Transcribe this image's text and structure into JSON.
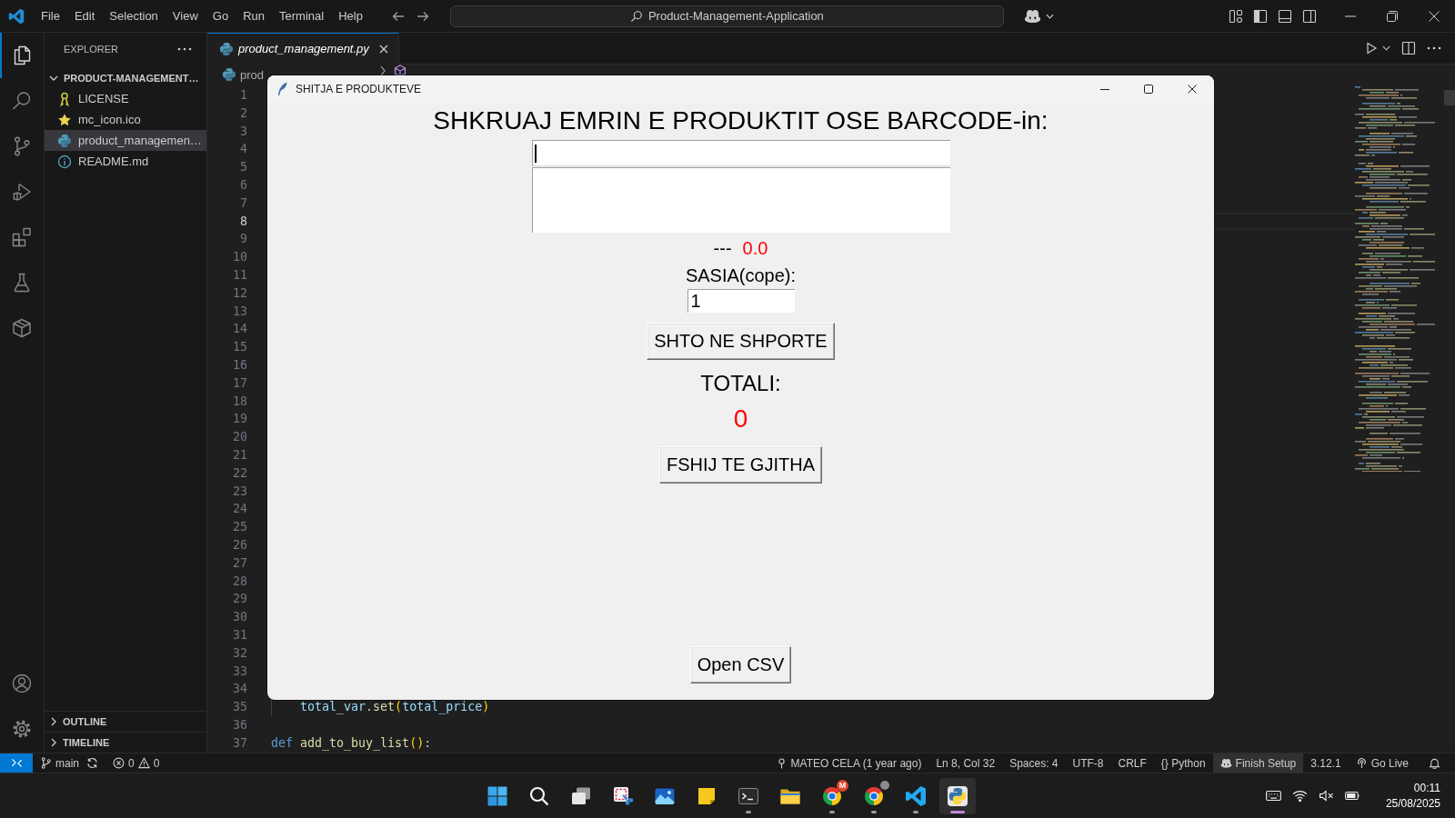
{
  "titlebar": {
    "menu": [
      "File",
      "Edit",
      "Selection",
      "View",
      "Go",
      "Run",
      "Terminal",
      "Help"
    ],
    "search": "Product-Management-Application"
  },
  "activity_bar": {
    "items": [
      {
        "kind": "explorer",
        "selected": true
      },
      {
        "kind": "search",
        "selected": false
      },
      {
        "kind": "source_control",
        "selected": false
      },
      {
        "kind": "run_debug",
        "selected": false
      },
      {
        "kind": "extensions",
        "selected": false
      },
      {
        "kind": "testing",
        "selected": false
      },
      {
        "kind": "containers",
        "selected": false
      }
    ]
  },
  "sidebar": {
    "title": "EXPLORER",
    "folder": {
      "name": "PRODUCT-MANAGEMENT…",
      "expanded": true,
      "children": [
        {
          "name": "LICENSE",
          "kind": "license",
          "selected": false
        },
        {
          "name": "mc_icon.ico",
          "kind": "image",
          "selected": false
        },
        {
          "name": "product_managemen…",
          "kind": "python",
          "selected": true
        },
        {
          "name": "README.md",
          "kind": "readme",
          "selected": false
        }
      ]
    },
    "sections": [
      {
        "name": "OUTLINE",
        "expanded": false
      },
      {
        "name": "TIMELINE",
        "expanded": false
      }
    ]
  },
  "tabs": [
    {
      "label": "product_management.py",
      "selected": true,
      "preview": true
    }
  ],
  "breadcrumb": {
    "file": "prod"
  },
  "editor": {
    "lines": [
      {
        "number": "1",
        "current": false
      },
      {
        "number": "2",
        "current": false
      },
      {
        "number": "3",
        "current": false
      },
      {
        "number": "4",
        "current": false
      },
      {
        "number": "5",
        "current": false
      },
      {
        "number": "6",
        "current": false
      },
      {
        "number": "7",
        "current": false
      },
      {
        "number": "8",
        "current": true
      },
      {
        "number": "9",
        "current": false
      },
      {
        "number": "10",
        "current": false
      },
      {
        "number": "11",
        "current": false
      },
      {
        "number": "12",
        "current": false
      },
      {
        "number": "13",
        "current": false
      },
      {
        "number": "14",
        "current": false
      },
      {
        "number": "15",
        "current": false
      },
      {
        "number": "16",
        "current": false
      },
      {
        "number": "17",
        "current": false
      },
      {
        "number": "18",
        "current": false
      },
      {
        "number": "19",
        "current": false
      },
      {
        "number": "20",
        "current": false
      },
      {
        "number": "21",
        "current": false
      },
      {
        "number": "22",
        "current": false
      },
      {
        "number": "23",
        "current": false
      },
      {
        "number": "24",
        "current": false
      },
      {
        "number": "25",
        "current": false
      },
      {
        "number": "26",
        "current": false
      },
      {
        "number": "27",
        "current": false
      },
      {
        "number": "28",
        "current": false
      },
      {
        "number": "29",
        "current": false
      },
      {
        "number": "30",
        "current": false
      },
      {
        "number": "31",
        "current": false
      },
      {
        "number": "32",
        "current": false
      },
      {
        "number": "33",
        "current": false
      },
      {
        "number": "34",
        "current": false
      },
      {
        "number": "35",
        "current": false,
        "indented": true,
        "code": [
          {
            "text": "total_var",
            "kind": "variable"
          },
          {
            "text": ".",
            "kind": "plain"
          },
          {
            "text": "set",
            "kind": "function"
          },
          {
            "text": "(",
            "kind": "bracket"
          },
          {
            "text": "total_price",
            "kind": "variable"
          },
          {
            "text": ")",
            "kind": "bracket"
          }
        ]
      },
      {
        "number": "36",
        "current": false
      },
      {
        "number": "37",
        "current": false,
        "indented": false,
        "code": [
          {
            "text": "def",
            "kind": "keyword"
          },
          {
            "text": " add_to_buy_list",
            "kind": "function"
          },
          {
            "text": "(",
            "kind": "bracket"
          },
          {
            "text": ")",
            "kind": "bracket"
          },
          {
            "text": ":",
            "kind": "plain"
          }
        ]
      }
    ]
  },
  "dialog": {
    "title": "SHITJA E PRODUKTEVE",
    "prompt": "SHKRUAJ EMRIN E PRODUKTIT OSE BARCODE-in:",
    "search_field": {
      "focused": true
    },
    "product_name": "---",
    "price": "0.0",
    "quantity_label": "SASIA(cope):",
    "quantity_field": {
      "value": "1"
    },
    "add_button": "SHTO NE SHPORTE",
    "total_label": "TOTALI:",
    "total": "0",
    "clear_button": "FSHIJ TE GJITHA",
    "csv_button": "Open CSV"
  },
  "status_bar": {
    "branch": "main",
    "errors": "0",
    "warnings": "0",
    "blame": "MATEO CELA (1 year ago)",
    "cursor": "Ln 8, Col 32",
    "indentation": "Spaces: 4",
    "encoding": "UTF-8",
    "line_ending": "CRLF",
    "language_icon": "{}",
    "language": "Python",
    "copilot": "Finish Setup",
    "interpreter": "3.12.1",
    "live_server": "Go Live"
  },
  "taskbar": {
    "items": [
      {
        "kind": "start",
        "running": false,
        "selected": false
      },
      {
        "kind": "search",
        "running": false,
        "selected": false
      },
      {
        "kind": "task_view",
        "running": false,
        "selected": false
      },
      {
        "kind": "snipping",
        "running": false,
        "selected": false
      },
      {
        "kind": "photos",
        "running": false,
        "selected": false
      },
      {
        "kind": "notes",
        "running": false,
        "selected": false
      },
      {
        "kind": "terminal",
        "running": true,
        "selected": false
      },
      {
        "kind": "files",
        "running": false,
        "selected": false
      },
      {
        "kind": "browser",
        "running": true,
        "selected": false,
        "badge": "M"
      },
      {
        "kind": "browser",
        "running": true,
        "selected": false,
        "avatar": true
      },
      {
        "kind": "code",
        "running": true,
        "selected": false
      },
      {
        "kind": "python",
        "running": true,
        "selected": true
      }
    ],
    "clock": {
      "time": "00:11",
      "date": "25/08/2025"
    }
  }
}
